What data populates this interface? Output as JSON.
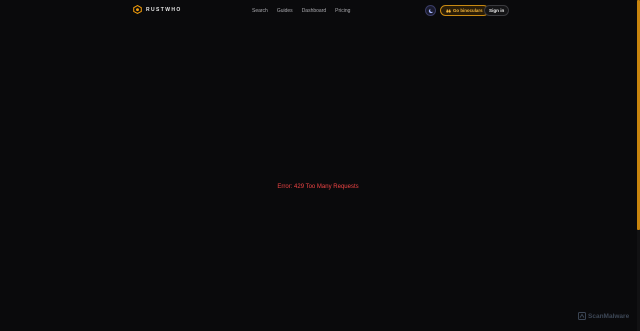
{
  "header": {
    "brand": {
      "name": "RUSTWHO",
      "icon": "rustwho-logo-icon"
    },
    "nav": [
      {
        "label": "Search"
      },
      {
        "label": "Guides"
      },
      {
        "label": "Dashboard"
      },
      {
        "label": "Pricing"
      }
    ],
    "theme_toggle_icon": "moon-icon",
    "binoculars_button": {
      "label": "Go binoculars",
      "icon": "binoculars-icon"
    },
    "signin_button": {
      "label": "Sign in"
    }
  },
  "main": {
    "error_message": "Error: 429 Too Many Requests"
  },
  "watermark": {
    "text": "ScanMalware",
    "icon": "scanmalware-logo-icon"
  },
  "colors": {
    "background": "#0a0a0c",
    "accent": "#f59e0b",
    "error": "#ef4444",
    "scrollbar": "#c8850f"
  }
}
